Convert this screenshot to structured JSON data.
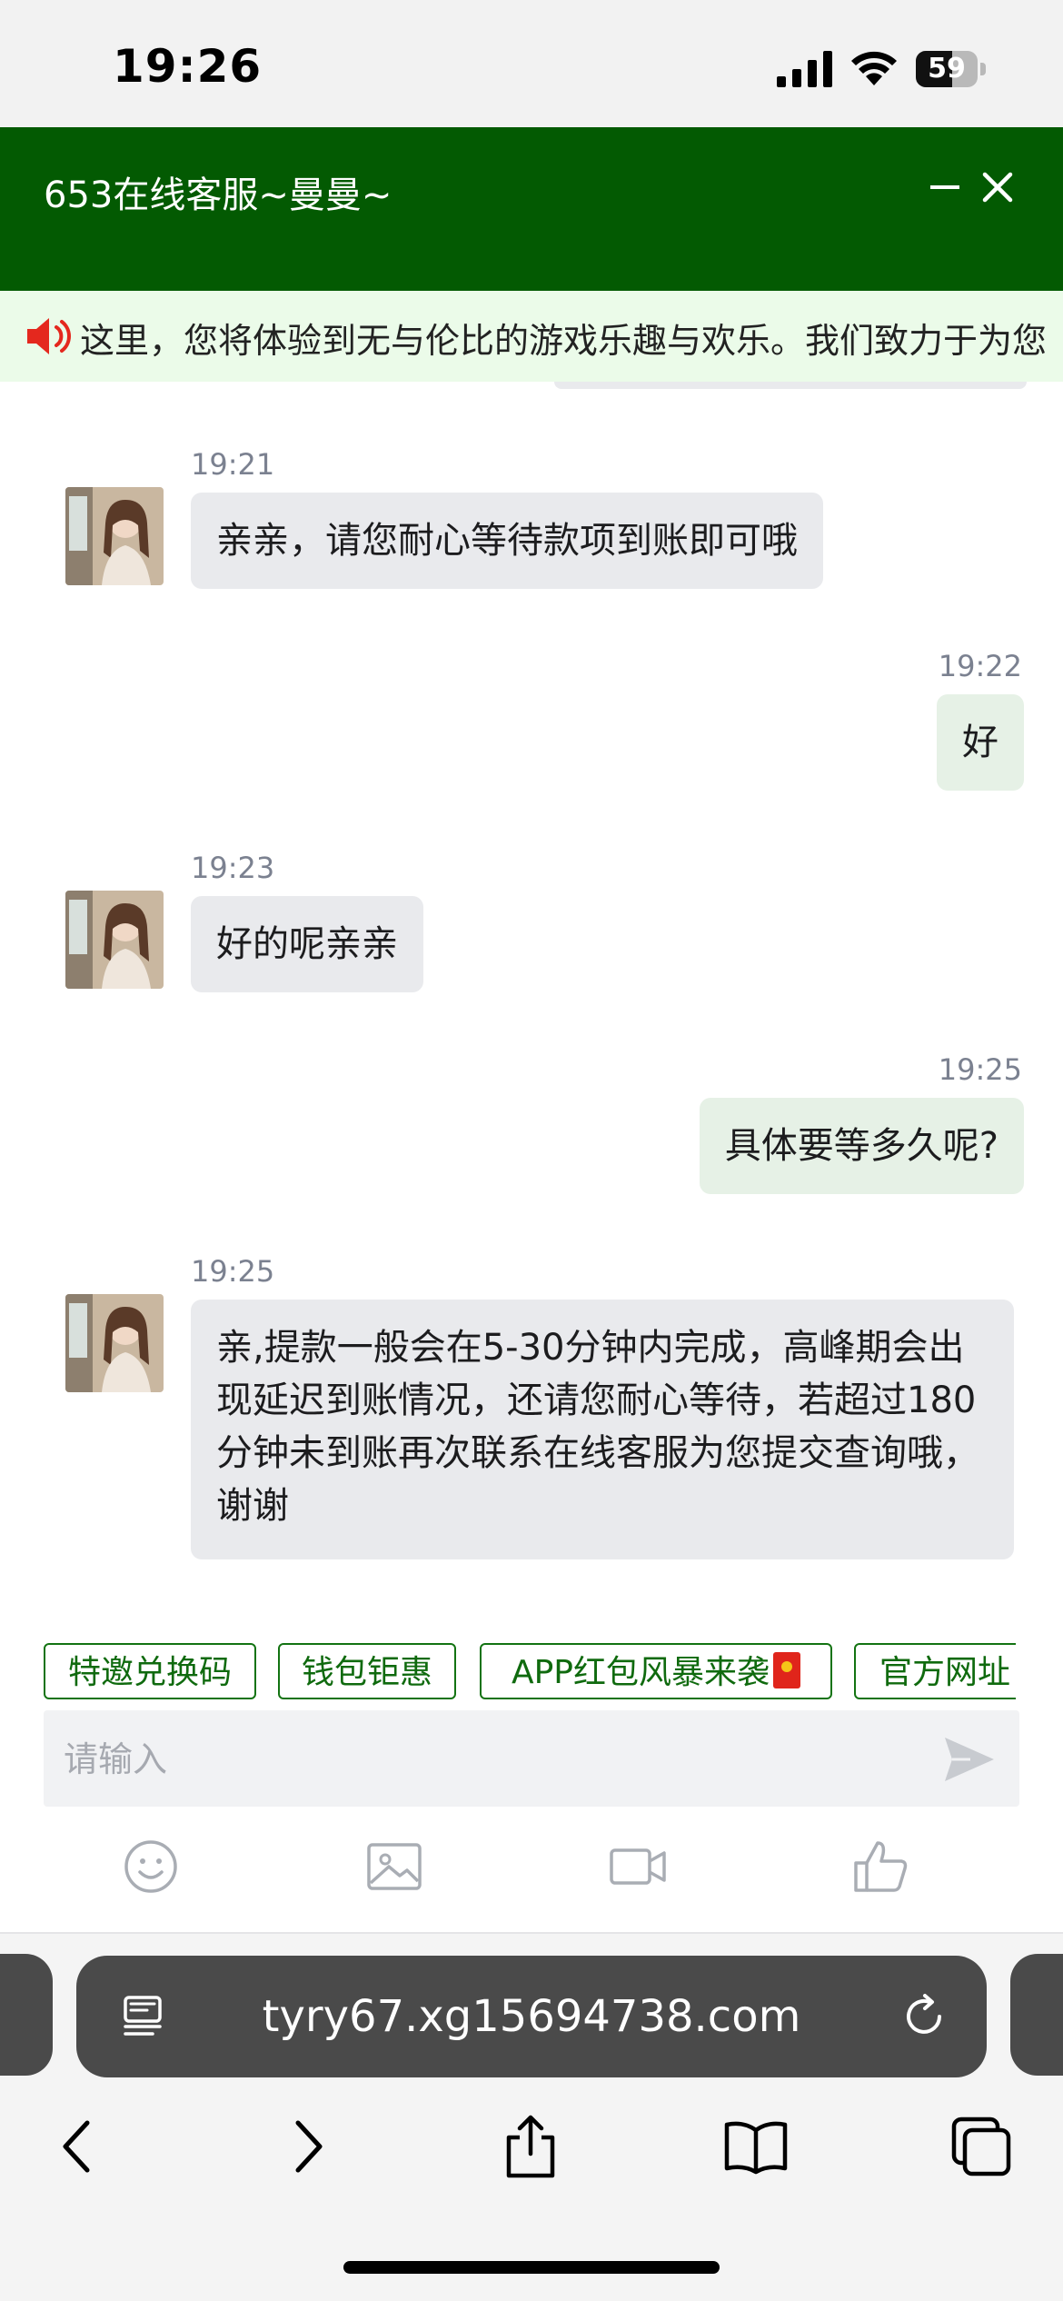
{
  "status_bar": {
    "time": "19:26",
    "battery": "59",
    "battery_level": 0.59
  },
  "header": {
    "title": "653在线客服~曼曼~"
  },
  "notice": {
    "text": "这里，您将体验到无与伦比的游戏乐趣与欢乐。我们致力于为您"
  },
  "messages": [
    {
      "side": "agent",
      "time": "19:21",
      "text": "亲亲，请您耐心等待款项到账即可哦"
    },
    {
      "side": "me",
      "time": "19:22",
      "text": "好"
    },
    {
      "side": "agent",
      "time": "19:23",
      "text": "好的呢亲亲"
    },
    {
      "side": "me",
      "time": "19:25",
      "text": "具体要等多久呢?"
    },
    {
      "side": "agent",
      "time": "19:25",
      "text": "亲,提款一般会在5-30分钟内完成，高峰期会出现延迟到账情况，还请您耐心等待，若超过180分钟未到账再次联系在线客服为您提交查询哦，谢谢"
    }
  ],
  "quick_replies": [
    "特邀兑换码",
    "钱包钜惠",
    "APP红包风暴来袭",
    "官方网址"
  ],
  "input": {
    "placeholder": "请输入",
    "value": ""
  },
  "toolbar": {
    "icons": [
      "emoji-icon",
      "image-icon",
      "video-icon",
      "thumbs-up-icon"
    ]
  },
  "browser": {
    "url": "tyry67.xg15694738.com"
  },
  "colors": {
    "header": "#035a02",
    "accent": "#137312",
    "agent_bubble": "#e9eaed",
    "user_bubble": "#e6f1e6"
  }
}
